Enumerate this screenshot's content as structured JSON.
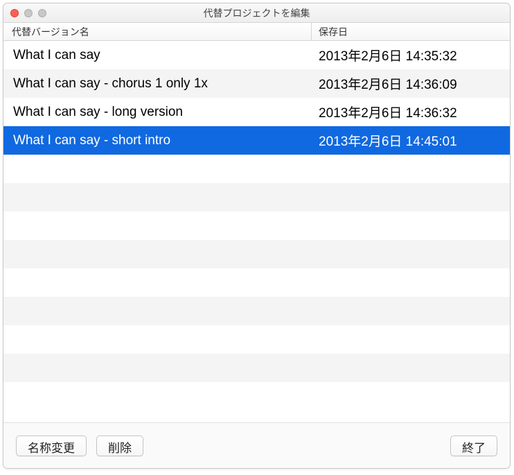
{
  "window": {
    "title": "代替プロジェクトを編集"
  },
  "columns": {
    "name": "代替バージョン名",
    "date": "保存日"
  },
  "rows": [
    {
      "name": "What I can say",
      "date": "2013年2月6日 14:35:32",
      "selected": false
    },
    {
      "name": "What I can say - chorus 1 only 1x",
      "date": "2013年2月6日 14:36:09",
      "selected": false
    },
    {
      "name": "What I can say - long version",
      "date": "2013年2月6日 14:36:32",
      "selected": false
    },
    {
      "name": "What I can say - short intro",
      "date": "2013年2月6日 14:45:01",
      "selected": true
    }
  ],
  "buttons": {
    "rename": "名称変更",
    "delete": "削除",
    "done": "終了"
  }
}
